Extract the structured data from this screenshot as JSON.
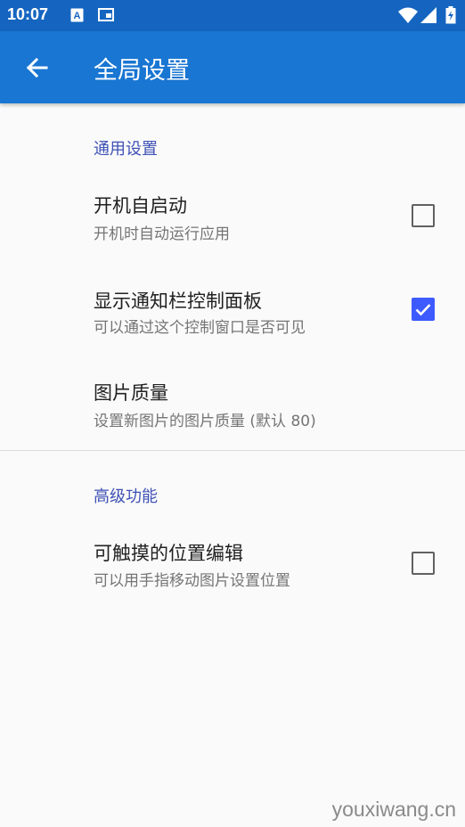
{
  "status_bar": {
    "time": "10:07"
  },
  "app_bar": {
    "title": "全局设置"
  },
  "sections": [
    {
      "header": "通用设置",
      "items": [
        {
          "title": "开机自启动",
          "summary": "开机时自动运行应用",
          "checked": false
        },
        {
          "title": "显示通知栏控制面板",
          "summary": "可以通过这个控制窗口是否可见",
          "checked": true
        },
        {
          "title": "图片质量",
          "summary": "设置新图片的图片质量 (默认 80)"
        }
      ]
    },
    {
      "header": "高级功能",
      "items": [
        {
          "title": "可触摸的位置编辑",
          "summary": "可以用手指移动图片设置位置",
          "checked": false
        }
      ]
    }
  ],
  "watermark": "youxiwang.cn",
  "colors": {
    "status_bar": "#1565c0",
    "app_bar": "#1976d2",
    "accent": "#3d5afe",
    "section_header": "#3f51b5"
  }
}
